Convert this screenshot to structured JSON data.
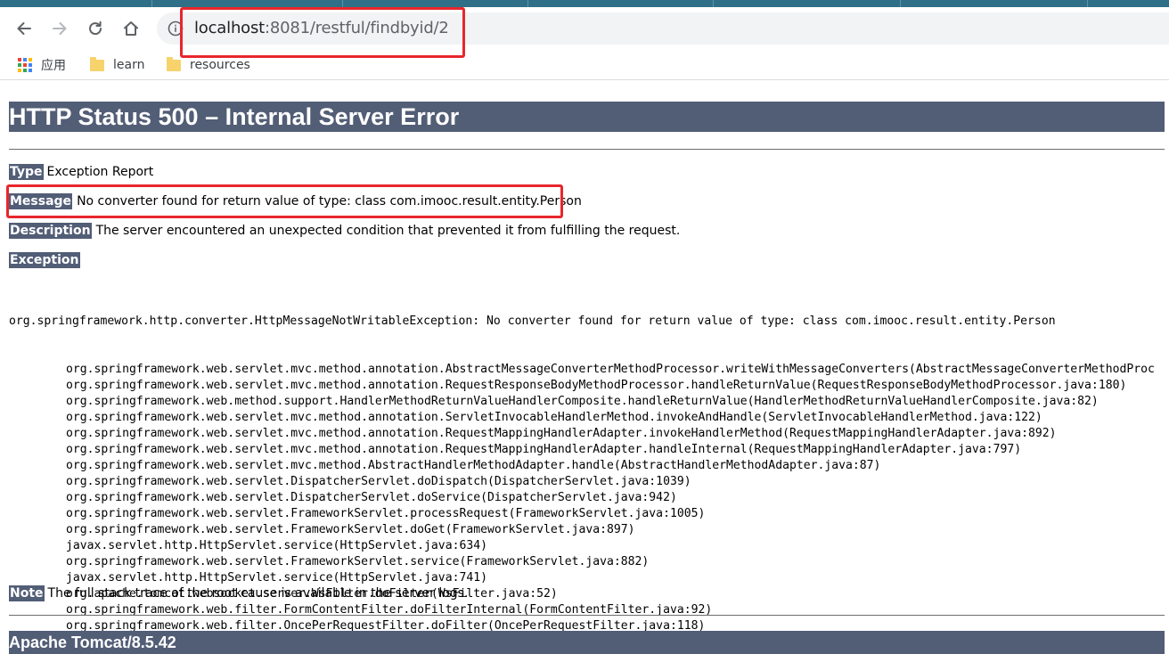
{
  "browser": {
    "url_host": "localhost",
    "url_rest": ":8081/restful/findbyid/2",
    "icons": {
      "back": "back-arrow-icon",
      "forward": "forward-arrow-icon",
      "reload": "reload-icon",
      "home": "home-icon",
      "site_info": "info-icon"
    },
    "bookmarks": [
      {
        "label": "应用",
        "icon": "apps-grid-icon"
      },
      {
        "label": "learn",
        "icon": "folder-icon"
      },
      {
        "label": "resources",
        "icon": "folder-icon"
      }
    ]
  },
  "page": {
    "title": "HTTP Status 500 – Internal Server Error",
    "type_label": "Type",
    "type_value": "Exception Report",
    "message_label": "Message",
    "message_value": "No converter found for return value of type: class com.imooc.result.entity.Person",
    "description_label": "Description",
    "description_value": "The server encountered an unexpected condition that prevented it from fulfilling the request.",
    "exception_label": "Exception",
    "exception_head": "org.springframework.http.converter.HttpMessageNotWritableException: No converter found for return value of type: class com.imooc.result.entity.Person",
    "stack_trace": [
      "org.springframework.web.servlet.mvc.method.annotation.AbstractMessageConverterMethodProcessor.writeWithMessageConverters(AbstractMessageConverterMethodProc",
      "org.springframework.web.servlet.mvc.method.annotation.RequestResponseBodyMethodProcessor.handleReturnValue(RequestResponseBodyMethodProcessor.java:180)",
      "org.springframework.web.method.support.HandlerMethodReturnValueHandlerComposite.handleReturnValue(HandlerMethodReturnValueHandlerComposite.java:82)",
      "org.springframework.web.servlet.mvc.method.annotation.ServletInvocableHandlerMethod.invokeAndHandle(ServletInvocableHandlerMethod.java:122)",
      "org.springframework.web.servlet.mvc.method.annotation.RequestMappingHandlerAdapter.invokeHandlerMethod(RequestMappingHandlerAdapter.java:892)",
      "org.springframework.web.servlet.mvc.method.annotation.RequestMappingHandlerAdapter.handleInternal(RequestMappingHandlerAdapter.java:797)",
      "org.springframework.web.servlet.mvc.method.AbstractHandlerMethodAdapter.handle(AbstractHandlerMethodAdapter.java:87)",
      "org.springframework.web.servlet.DispatcherServlet.doDispatch(DispatcherServlet.java:1039)",
      "org.springframework.web.servlet.DispatcherServlet.doService(DispatcherServlet.java:942)",
      "org.springframework.web.servlet.FrameworkServlet.processRequest(FrameworkServlet.java:1005)",
      "org.springframework.web.servlet.FrameworkServlet.doGet(FrameworkServlet.java:897)",
      "javax.servlet.http.HttpServlet.service(HttpServlet.java:634)",
      "org.springframework.web.servlet.FrameworkServlet.service(FrameworkServlet.java:882)",
      "javax.servlet.http.HttpServlet.service(HttpServlet.java:741)",
      "org.apache.tomcat.websocket.server.WsFilter.doFilter(WsFilter.java:52)",
      "org.springframework.web.filter.FormContentFilter.doFilterInternal(FormContentFilter.java:92)",
      "org.springframework.web.filter.OncePerRequestFilter.doFilter(OncePerRequestFilter.java:118)"
    ],
    "note_label": "Note",
    "note_value": "The full stack trace of the root cause is available in the server logs.",
    "footer": "Apache Tomcat/8.5.42"
  },
  "colors": {
    "header_bg": "#525d76",
    "annotation": "#e8262d",
    "tabstrip": "#2f6f87"
  }
}
